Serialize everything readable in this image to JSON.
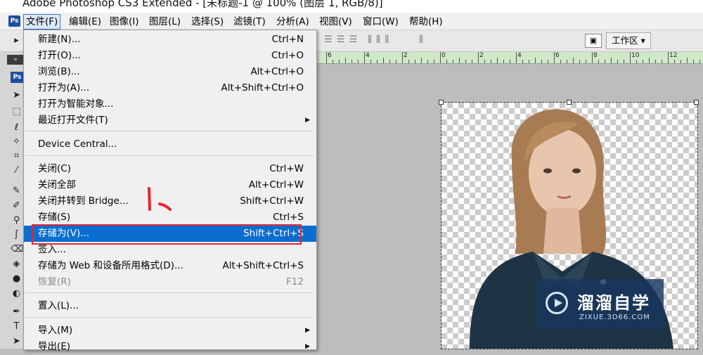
{
  "window": {
    "title": "Adobe Photoshop CS3 Extended - [未标题-1 @ 100% (图层 1, RGB/8)]"
  },
  "menubar": [
    "文件(F)",
    "编辑(E)",
    "图像(I)",
    "图层(L)",
    "选择(S)",
    "滤镜(T)",
    "分析(A)",
    "视图(V)",
    "窗口(W)",
    "帮助(H)"
  ],
  "options_bar": {
    "workspace_label": "工作区 ▾"
  },
  "ruler_labels": [
    "6",
    "4",
    "2",
    "0",
    "2",
    "4",
    "6",
    "8",
    "10",
    "12"
  ],
  "file_menu": {
    "items": [
      {
        "label": "新建(N)...",
        "shortcut": "Ctrl+N"
      },
      {
        "label": "打开(O)...",
        "shortcut": "Ctrl+O"
      },
      {
        "label": "浏览(B)...",
        "shortcut": "Alt+Ctrl+O"
      },
      {
        "label": "打开为(A)...",
        "shortcut": "Alt+Shift+Ctrl+O"
      },
      {
        "label": "打开为智能对象...",
        "shortcut": ""
      },
      {
        "label": "最近打开文件(T)",
        "shortcut": ""
      },
      {
        "label": "Device Central...",
        "shortcut": ""
      },
      {
        "label": "关闭(C)",
        "shortcut": "Ctrl+W"
      },
      {
        "label": "关闭全部",
        "shortcut": "Alt+Ctrl+W"
      },
      {
        "label": "关闭并转到 Bridge...",
        "shortcut": "Shift+Ctrl+W"
      },
      {
        "label": "存储(S)",
        "shortcut": "Ctrl+S"
      },
      {
        "label": "存储为(V)...",
        "shortcut": "Shift+Ctrl+S"
      },
      {
        "label": "签入...",
        "shortcut": ""
      },
      {
        "label": "存储为 Web 和设备所用格式(D)...",
        "shortcut": "Alt+Shift+Ctrl+S"
      },
      {
        "label": "恢复(R)",
        "shortcut": "F12"
      },
      {
        "label": "置入(L)...",
        "shortcut": ""
      },
      {
        "label": "导入(M)",
        "shortcut": ""
      },
      {
        "label": "导出(E)",
        "shortcut": ""
      }
    ]
  },
  "annotation": {
    "step": "1、"
  },
  "watermark": {
    "title": "溜溜自学",
    "url": "ZIXUE.3D66.COM"
  },
  "colors": {
    "highlight": "#0a6ed1",
    "annotation": "#e5262f",
    "ruler": "#cfe8c8"
  }
}
